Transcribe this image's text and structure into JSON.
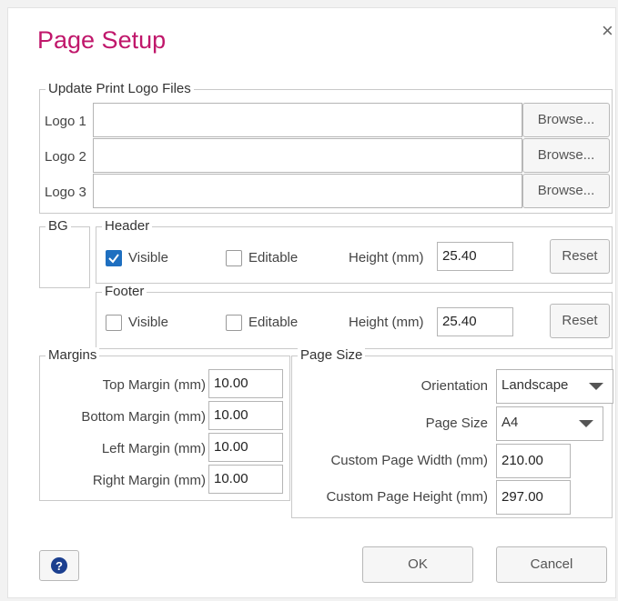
{
  "dialog": {
    "title": "Page Setup",
    "close_glyph": "×"
  },
  "logos": {
    "legend": "Update Print Logo Files",
    "rows": [
      {
        "label": "Logo 1",
        "value": "",
        "button": "Browse..."
      },
      {
        "label": "Logo 2",
        "value": "",
        "button": "Browse..."
      },
      {
        "label": "Logo 3",
        "value": "",
        "button": "Browse..."
      }
    ]
  },
  "bg": {
    "legend": "BG"
  },
  "header": {
    "legend": "Header",
    "visible_label": "Visible",
    "visible_checked": true,
    "editable_label": "Editable",
    "editable_checked": false,
    "height_label": "Height (mm)",
    "height_value": "25.40",
    "reset_label": "Reset"
  },
  "footer": {
    "legend": "Footer",
    "visible_label": "Visible",
    "visible_checked": false,
    "editable_label": "Editable",
    "editable_checked": false,
    "height_label": "Height (mm)",
    "height_value": "25.40",
    "reset_label": "Reset"
  },
  "margins": {
    "legend": "Margins",
    "top_label": "Top Margin (mm)",
    "top_value": "10.00",
    "bottom_label": "Bottom Margin (mm)",
    "bottom_value": "10.00",
    "left_label": "Left Margin (mm)",
    "left_value": "10.00",
    "right_label": "Right Margin (mm)",
    "right_value": "10.00"
  },
  "page_size": {
    "legend": "Page Size",
    "orientation_label": "Orientation",
    "orientation_value": "Landscape",
    "size_label": "Page Size",
    "size_value": "A4",
    "width_label": "Custom Page Width (mm)",
    "width_value": "210.00",
    "height_label": "Custom Page Height (mm)",
    "height_value": "297.00"
  },
  "footer_buttons": {
    "help_icon": "question-circle-icon",
    "ok_label": "OK",
    "cancel_label": "Cancel"
  },
  "colors": {
    "title": "#c0176b",
    "checkbox_on": "#1e6fc0",
    "help_icon": "#1b3f8f"
  }
}
